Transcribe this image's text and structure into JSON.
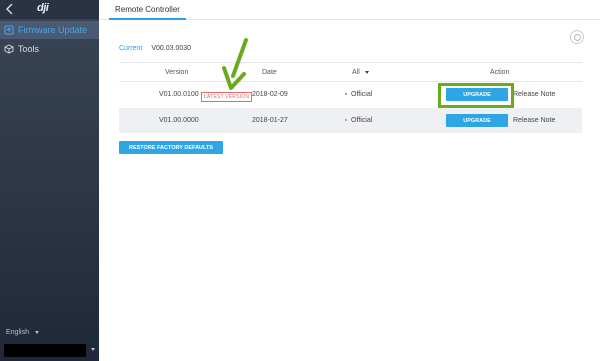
{
  "sidebar": {
    "logo": "dji",
    "items": [
      {
        "label": "Firmware Update"
      },
      {
        "label": "Tools"
      }
    ],
    "language": "English"
  },
  "tabs": [
    {
      "label": "Remote Controller"
    }
  ],
  "current": {
    "label": "Current",
    "value": "V00.03.0030"
  },
  "table": {
    "headers": {
      "version": "Version",
      "date": "Date",
      "filter": "All",
      "action": "Action"
    },
    "rows": [
      {
        "version": "V01.00.0100",
        "badge": "LATEST VERSION",
        "date": "2018-02-09",
        "type": "Official",
        "button": "UPGRADE",
        "note": "Release Note"
      },
      {
        "version": "V01.00.0000",
        "date": "2018-01-27",
        "type": "Official",
        "button": "UPGRADE",
        "note": "Release Note"
      }
    ]
  },
  "restore_button": "RESTORE FACTORY DEFAULTS",
  "colors": {
    "accent": "#2ea6e6",
    "highlight": "#6aaa1e",
    "badge": "#e06a6a",
    "sidebar": "#2c3646"
  }
}
